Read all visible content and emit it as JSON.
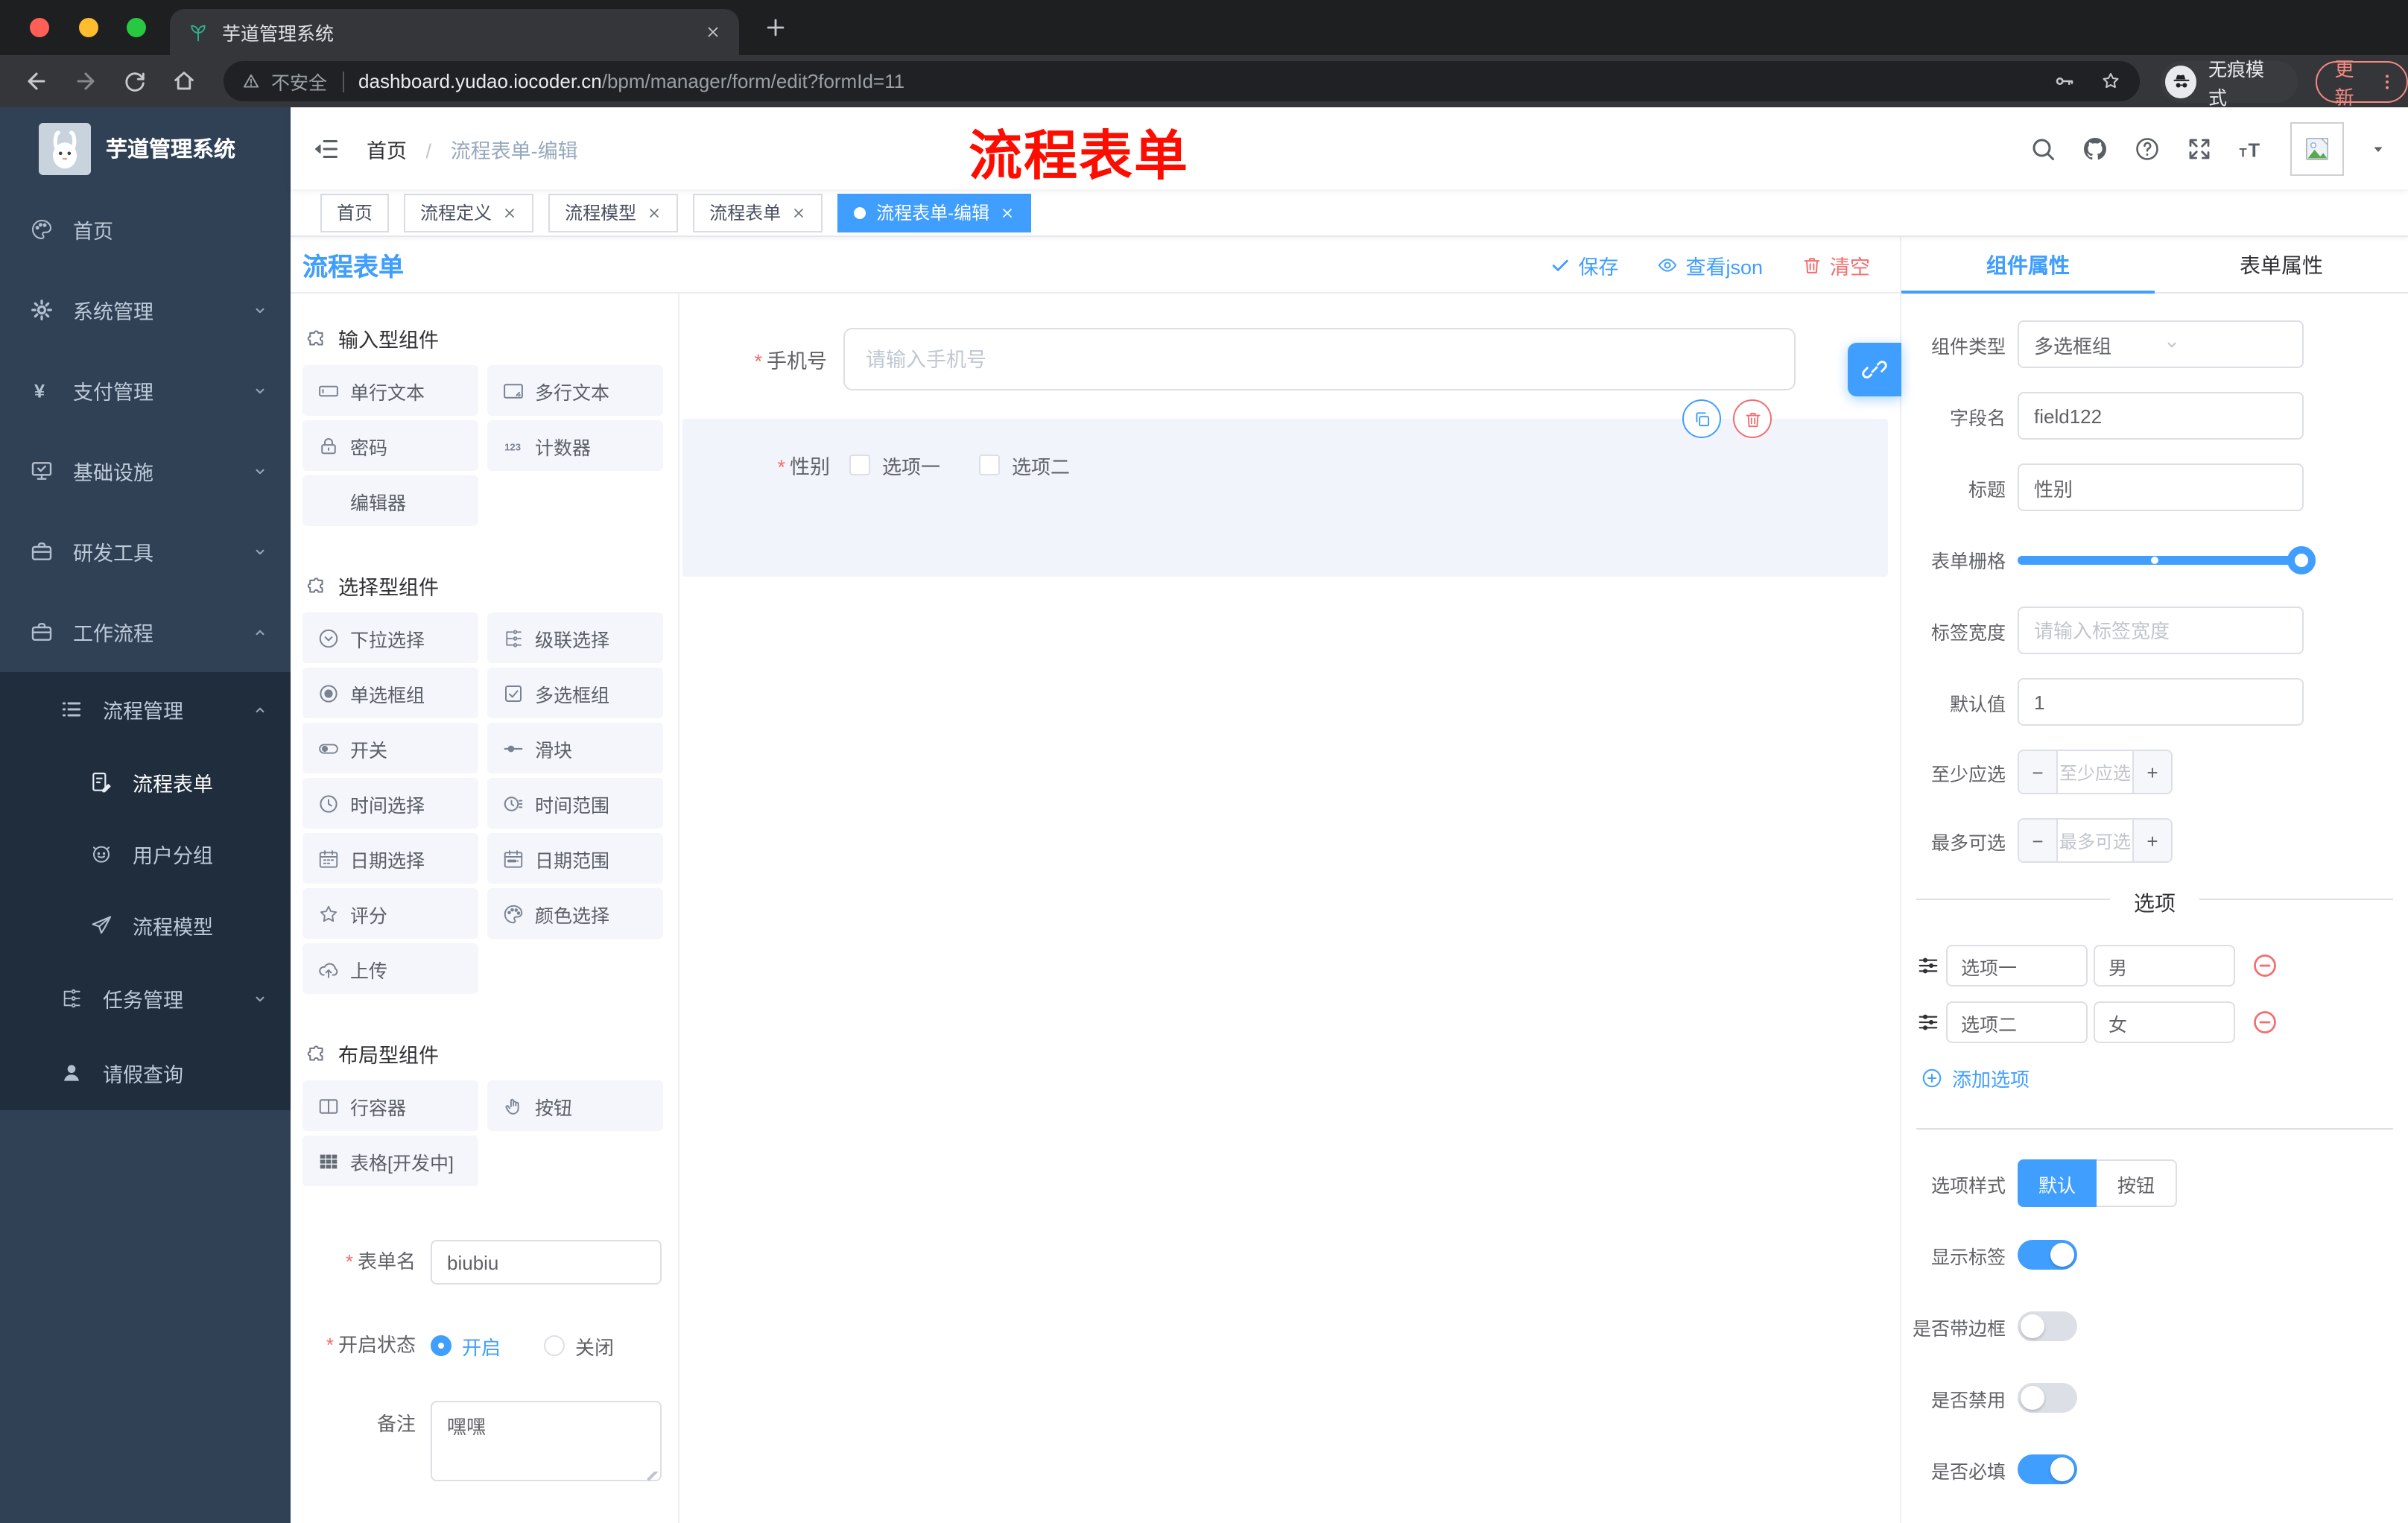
{
  "ui": {
    "required_mark": "*"
  },
  "browser": {
    "tab_title": "芋道管理系统",
    "security": "不安全",
    "url_host": "dashboard.yudao.iocoder.cn",
    "url_path": "/bpm/manager/form/edit?formId=11",
    "incognito": "无痕模式",
    "update": "更新"
  },
  "annotation": {
    "text": "流程表单",
    "color": "#fc0d00"
  },
  "sidebar": {
    "title": "芋道管理系统",
    "menu": [
      {
        "label": "首页"
      },
      {
        "label": "系统管理"
      },
      {
        "label": "支付管理"
      },
      {
        "label": "基础设施"
      },
      {
        "label": "研发工具"
      },
      {
        "label": "工作流程"
      }
    ],
    "submenu": [
      {
        "label": "流程管理"
      },
      {
        "label": "流程表单"
      },
      {
        "label": "用户分组"
      },
      {
        "label": "流程模型"
      },
      {
        "label": "任务管理"
      },
      {
        "label": "请假查询"
      }
    ]
  },
  "header": {
    "breadcrumb_home": "首页",
    "breadcrumb_sep": "/",
    "breadcrumb_current": "流程表单-编辑"
  },
  "tags": [
    {
      "label": "首页"
    },
    {
      "label": "流程定义"
    },
    {
      "label": "流程模型"
    },
    {
      "label": "流程表单"
    },
    {
      "label": "流程表单-编辑"
    }
  ],
  "toolbar": {
    "title": "流程表单",
    "save": "保存",
    "view_json": "查看json",
    "clear": "清空"
  },
  "palette": {
    "section1": {
      "title": "输入型组件",
      "items": [
        {
          "label": "单行文本"
        },
        {
          "label": "多行文本"
        },
        {
          "label": "密码"
        },
        {
          "label": "计数器"
        },
        {
          "label": "编辑器"
        }
      ]
    },
    "section2": {
      "title": "选择型组件",
      "items": [
        {
          "label": "下拉选择"
        },
        {
          "label": "级联选择"
        },
        {
          "label": "单选框组"
        },
        {
          "label": "多选框组"
        },
        {
          "label": "开关"
        },
        {
          "label": "滑块"
        },
        {
          "label": "时间选择"
        },
        {
          "label": "时间范围"
        },
        {
          "label": "日期选择"
        },
        {
          "label": "日期范围"
        },
        {
          "label": "评分"
        },
        {
          "label": "颜色选择"
        },
        {
          "label": "上传"
        }
      ]
    },
    "section3": {
      "title": "布局型组件",
      "items": [
        {
          "label": "行容器"
        },
        {
          "label": "按钮"
        },
        {
          "label": "表格[开发中]"
        }
      ]
    }
  },
  "meta_form": {
    "name_label": "表单名",
    "name_value": "biubiu",
    "status_label": "开启状态",
    "status_on": "开启",
    "status_off": "关闭",
    "remark_label": "备注",
    "remark_value": "嘿嘿"
  },
  "canvas": {
    "phone": {
      "label": "手机号",
      "placeholder": "请输入手机号"
    },
    "gender": {
      "label": "性别",
      "option1": "选项一",
      "option2": "选项二"
    }
  },
  "panel": {
    "tab_component": "组件属性",
    "tab_form": "表单属性",
    "rows": {
      "type_label": "组件类型",
      "type_value": "多选框组",
      "field_label": "字段名",
      "field_value": "field122",
      "title_label": "标题",
      "title_value": "性别",
      "grid_label": "表单栅格",
      "labelwidth_label": "标签宽度",
      "labelwidth_placeholder": "请输入标签宽度",
      "default_label": "默认值",
      "default_value": "1",
      "min_label": "至少应选",
      "min_placeholder": "至少应选",
      "max_label": "最多可选",
      "max_placeholder": "最多可选"
    },
    "options_title": "选项",
    "options": [
      {
        "label": "选项一",
        "value": "男"
      },
      {
        "label": "选项二",
        "value": "女"
      }
    ],
    "add_option": "添加选项",
    "style_label": "选项样式",
    "style_default": "默认",
    "style_button": "按钮",
    "switch_show_label": "显示标签",
    "switch_border": "是否带边框",
    "switch_disabled": "是否禁用",
    "switch_required": "是否必填",
    "accent_color": "#409eff",
    "danger_color": "#f56c6c"
  }
}
